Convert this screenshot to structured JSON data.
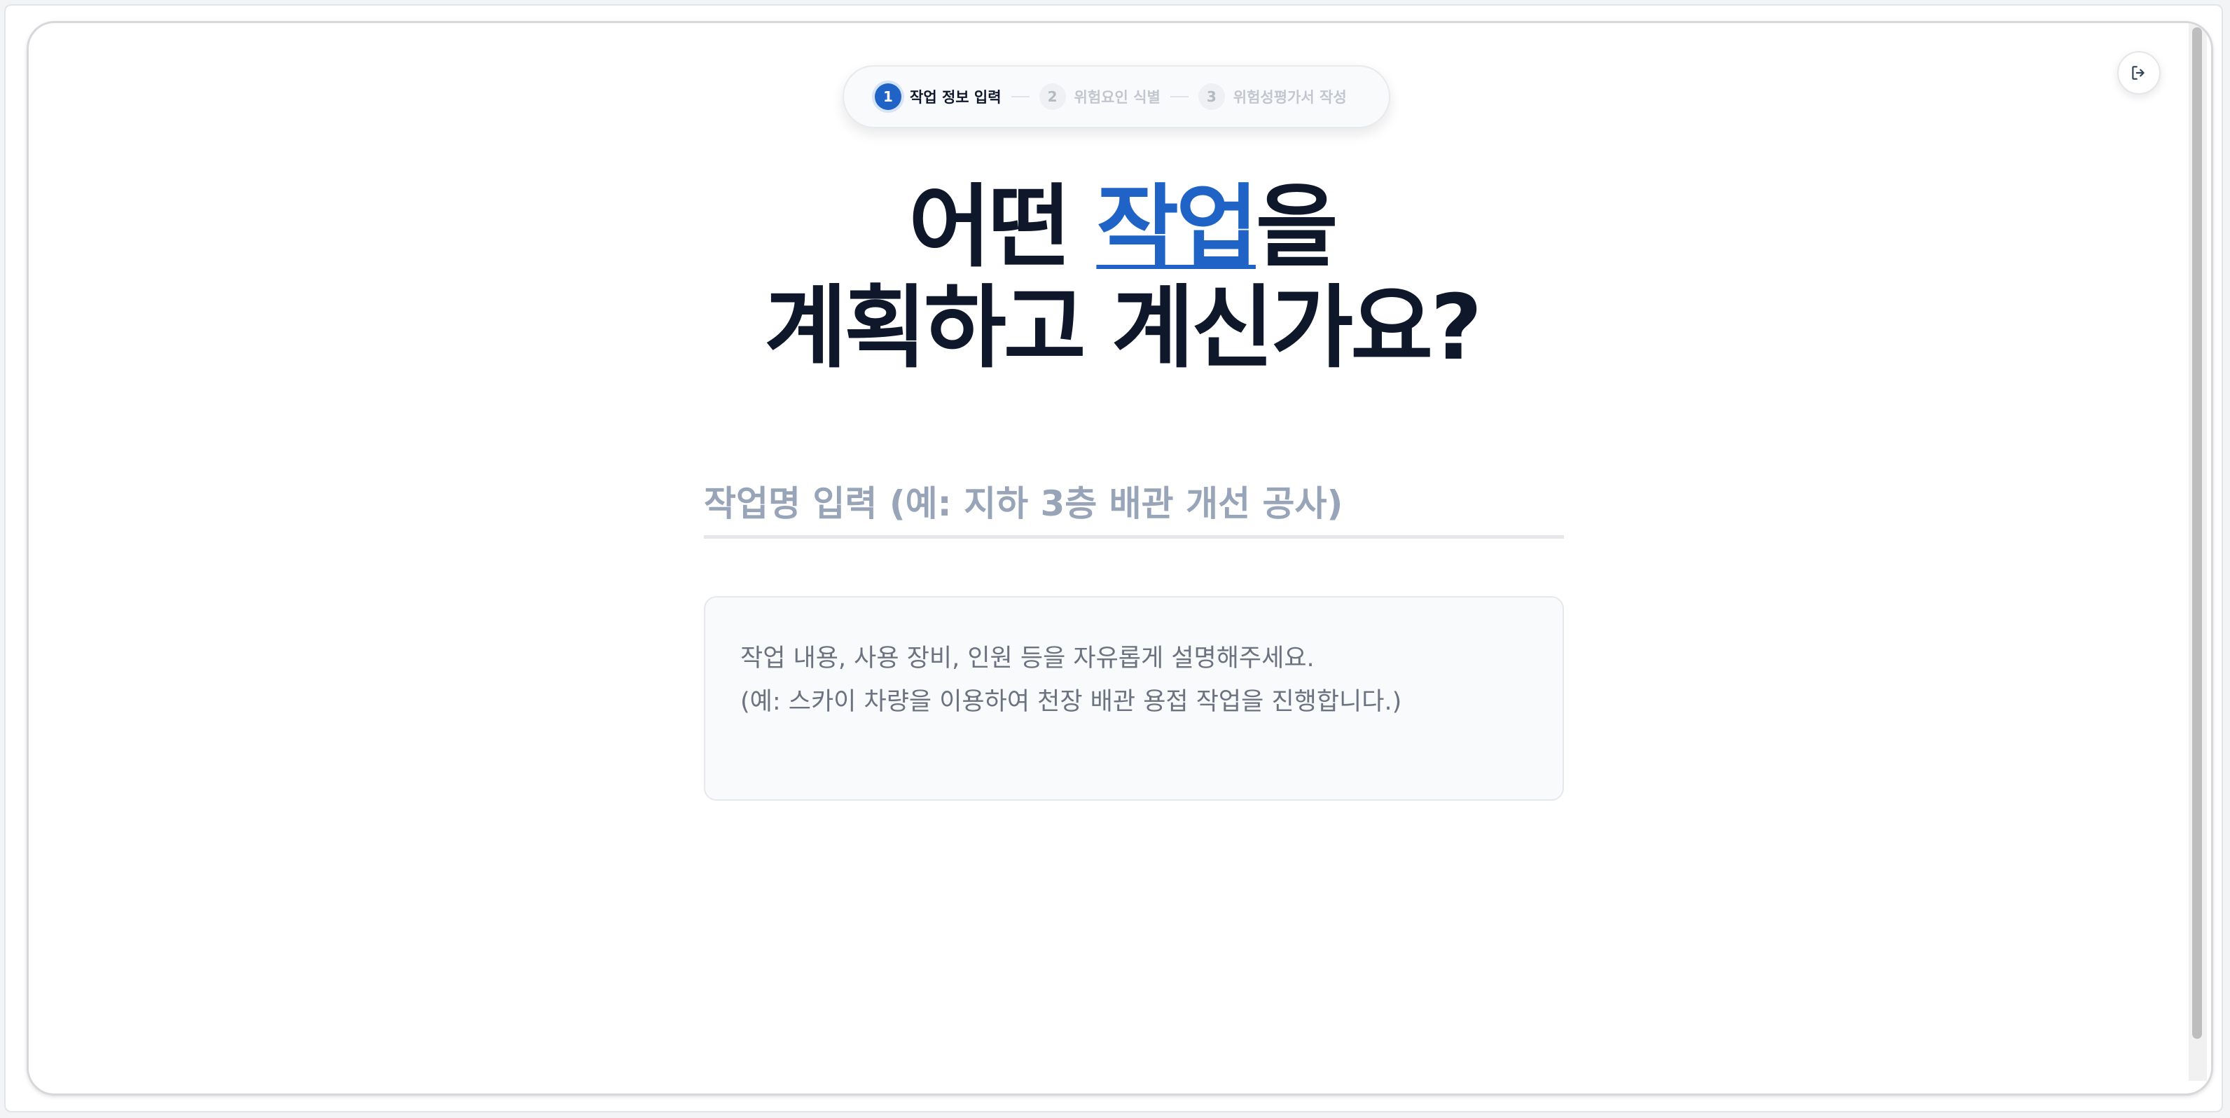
{
  "stepper": {
    "steps": [
      {
        "number": "1",
        "label": "작업 정보 입력",
        "state": "active"
      },
      {
        "number": "2",
        "label": "위험요인 식별",
        "state": "inactive"
      },
      {
        "number": "3",
        "label": "위험성평가서 작성",
        "state": "inactive"
      }
    ]
  },
  "header": {
    "exit_icon": "logout-icon"
  },
  "headline": {
    "line1_prefix": "어떤 ",
    "line1_accent": "작업",
    "line1_suffix": "을",
    "line2": "계획하고 계신가요?"
  },
  "form": {
    "title_placeholder": "작업명 입력 (예: 지하 3층 배관 개선 공사)",
    "title_value": "",
    "description_placeholder": "작업 내용, 사용 장비, 인원 등을 자유롭게 설명해주세요.\n(예: 스카이 차량을 이용하여 천장 배관 용접 작업을 진행합니다.)",
    "description_value": ""
  },
  "colors": {
    "accent": "#1f63c6",
    "heading": "#0f172a",
    "placeholder": "#98a4b8"
  }
}
